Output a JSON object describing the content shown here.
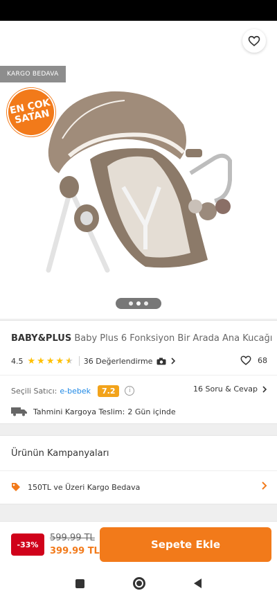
{
  "badges": {
    "cargo": "KARGO BEDAVA",
    "best_line1": "EN ÇOK",
    "best_line2": "SATAN"
  },
  "product": {
    "brand": "BABY&PLUS",
    "name": "Baby Plus 6 Fonksiyon Bir Arada Ana Kucağı",
    "rating": "4.5",
    "stars": 4.5,
    "reviews": "36 Değerlendirme",
    "likes": "68"
  },
  "seller": {
    "label": "Seçili Satıcı:",
    "name": "e-bebek",
    "score": "7.2",
    "qa": "16 Soru & Cevap"
  },
  "delivery": {
    "label": "Tahmini Kargoya Teslim:",
    "value": "2 Gün içinde"
  },
  "campaigns": {
    "title": "Ürünün Kampanyaları",
    "item": "150TL ve Üzeri Kargo Bedava"
  },
  "price": {
    "discount": "-33%",
    "old": "599.99 TL",
    "new": "399.99 TL"
  },
  "cart_button": "Sepete Ekle",
  "carousel": {
    "total": 3,
    "active": 2
  },
  "colors": {
    "accent": "#f27a1a",
    "discount": "#d0021b",
    "seller_link": "#1e88e5",
    "score": "#f2a31b",
    "star": "#ffc000"
  }
}
